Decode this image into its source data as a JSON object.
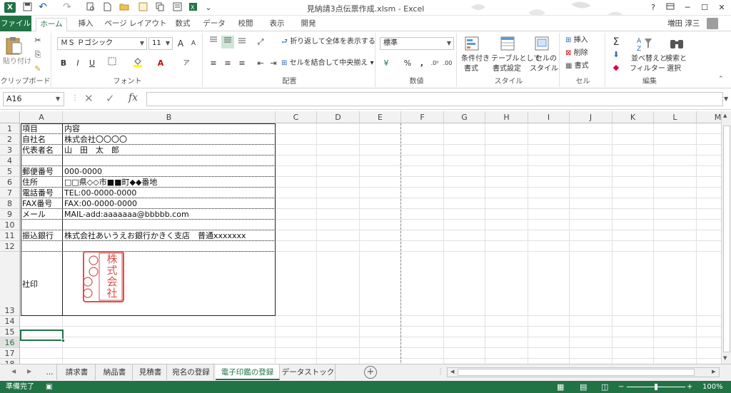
{
  "window": {
    "title": "見納請3点伝票作成.xlsm - Excel",
    "help": "?",
    "minimize": "─",
    "maximize": "☐",
    "close": "✕"
  },
  "quick_access": {
    "save_icon": "save-icon",
    "undo": "↶",
    "redo": "↷",
    "more": "⌄"
  },
  "ribbon_tabs": [
    "ファイル",
    "ホーム",
    "挿入",
    "ページ レイアウト",
    "数式",
    "データ",
    "校閲",
    "表示",
    "開発"
  ],
  "user_name": "増田 淳三",
  "ribbon": {
    "clipboard": {
      "paste": "貼り付け",
      "label": "クリップボード"
    },
    "font": {
      "name": "ＭＳ Ｐゴシック",
      "size": "11",
      "bold": "B",
      "italic": "I",
      "underline": "U",
      "label": "フォント",
      "grow": "A",
      "shrink": "A"
    },
    "alignment": {
      "wrap": "折り返して全体を表示する",
      "merge": "セルを結合して中央揃え",
      "label": "配置"
    },
    "number": {
      "format": "標準",
      "percent": "%",
      "comma": ",",
      "label": "数値"
    },
    "styles": {
      "conditional": "条件付き",
      "conditional2": "書式",
      "table": "テーブルとして",
      "table2": "書式設定",
      "cell": "セルの",
      "cell2": "スタイル",
      "label": "スタイル"
    },
    "cells": {
      "insert": "挿入",
      "delete": "削除",
      "format": "書式",
      "label": "セル"
    },
    "editing": {
      "sort": "並べ替えと",
      "sort2": "フィルター",
      "find": "検索と",
      "find2": "選択",
      "label": "編集"
    }
  },
  "formula_bar": {
    "name_box": "A16",
    "cancel": "✕",
    "enter": "✓",
    "fx": "fx",
    "value": ""
  },
  "columns": [
    "A",
    "B",
    "C",
    "D",
    "E",
    "F",
    "G",
    "H",
    "I",
    "J",
    "K",
    "L",
    "M"
  ],
  "rows": [
    "1",
    "2",
    "3",
    "4",
    "5",
    "6",
    "7",
    "8",
    "9",
    "10",
    "11",
    "12",
    "13",
    "14",
    "15",
    "16",
    "17",
    "18"
  ],
  "cells": {
    "A1": "項目",
    "B1": "内容",
    "A2": "自社名",
    "B2": "株式会社〇〇〇〇",
    "A3": "代表者名",
    "B3": "山　田　太　郎",
    "A5": "郵便番号",
    "B5": "000-0000",
    "A6": "住所",
    "B6": "□□県◇◇市■■町◆◆番地",
    "A7": "電話番号",
    "B7": "TEL:00-0000-0000",
    "A8": "FAX番号",
    "B8": "FAX:00-0000-0000",
    "A9": "メール",
    "B9": "MAIL-add:aaaaaaa@bbbbb.com",
    "A11": "振込銀行",
    "B11": "株式会社あいうえお銀行かきく支店　普通xxxxxxx",
    "A13": "社印"
  },
  "seal": {
    "chars": [
      "株",
      "式",
      "会",
      "社"
    ],
    "color": "#d9534f"
  },
  "sheet_tabs": [
    "...",
    "請求書",
    "納品書",
    "見積書",
    "宛名の登録",
    "電子印鑑の登録",
    "データストック"
  ],
  "active_sheet": "電子印鑑の登録",
  "status": {
    "ready": "準備完了",
    "zoom": "100%"
  },
  "colors": {
    "accent": "#217346"
  }
}
